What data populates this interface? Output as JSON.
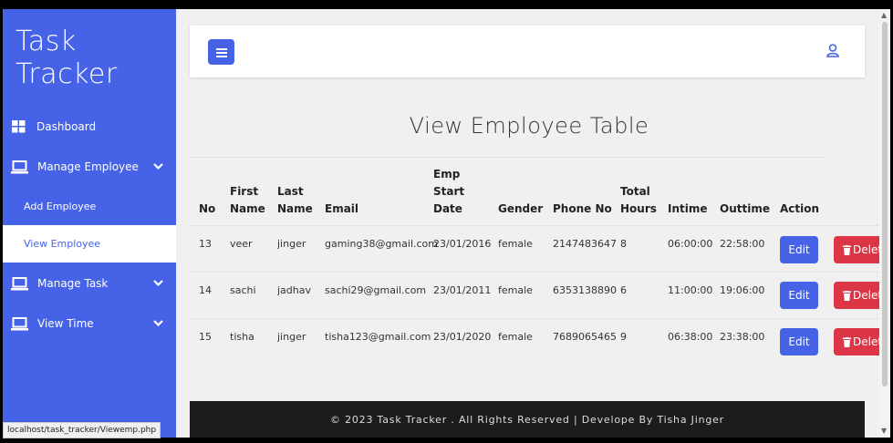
{
  "sidebar": {
    "brand_line1": "Task",
    "brand_line2": "Tracker",
    "items": [
      {
        "label": "Dashboard",
        "icon": "grid-icon"
      },
      {
        "label": "Manage Employee",
        "icon": "laptop-icon"
      },
      {
        "label": "Add Employee"
      },
      {
        "label": "View Employee"
      },
      {
        "label": "Manage Task",
        "icon": "laptop-icon"
      },
      {
        "label": "View Time",
        "icon": "laptop-icon"
      }
    ]
  },
  "header": {
    "menu_icon": "hamburger-icon",
    "user_icon": "user-icon"
  },
  "page_title": "View Employee Table",
  "table": {
    "headers": {
      "no": "No",
      "first1": "First",
      "first2": "Name",
      "last1": "Last",
      "last2": "Name",
      "email": "Email",
      "emp1": "Emp",
      "emp2": "Start",
      "emp3": "Date",
      "gender": "Gender",
      "phone": "Phone No",
      "total1": "Total",
      "total2": "Hours",
      "intime": "Intime",
      "outtime": "Outtime",
      "action": "Action"
    },
    "rows": [
      {
        "no": "13",
        "first": "veer",
        "last": "jinger",
        "email": "gaming38@gmail.com",
        "date": "23/01/2016",
        "gender": "female",
        "phone": "2147483647",
        "hours": "8",
        "intime": "06:00:00",
        "outtime": "22:58:00",
        "edit": "Edit",
        "delete": "Delet"
      },
      {
        "no": "14",
        "first": "sachi",
        "last": "jadhav",
        "email": "sachi29@gmail.com",
        "date": "23/01/2011",
        "gender": "female",
        "phone": "6353138890",
        "hours": "6",
        "intime": "11:00:00",
        "outtime": "19:06:00",
        "edit": "Edit",
        "delete": "Delet"
      },
      {
        "no": "15",
        "first": "tisha",
        "last": "jinger",
        "email": "tisha123@gmail.com",
        "date": "23/01/2020",
        "gender": "female",
        "phone": "7689065465",
        "hours": "9",
        "intime": "06:38:00",
        "outtime": "23:38:00",
        "edit": "Edit",
        "delete": "Delet"
      }
    ]
  },
  "footer": "© 2023 Task Tracker . All Rights Reserved | Develope By Tisha Jinger",
  "status_url": "localhost/task_tracker/Viewemp.php",
  "colors": {
    "primary": "#4662e6",
    "danger": "#dc3545",
    "footer_bg": "#1c1c1c"
  }
}
